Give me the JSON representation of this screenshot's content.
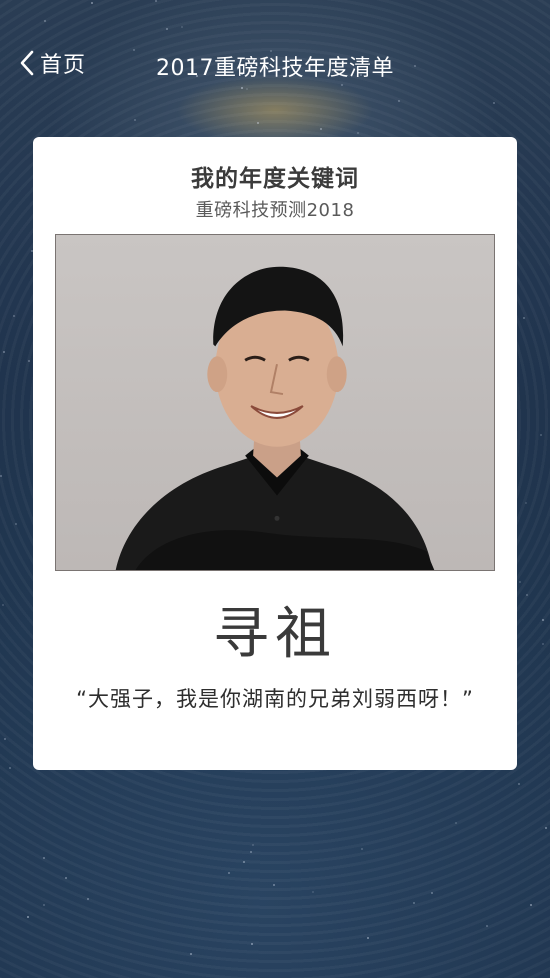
{
  "nav": {
    "back_label": "首页",
    "title": "2017重磅科技年度清单"
  },
  "card": {
    "title": "我的年度关键词",
    "subtitle": "重磅科技预测2018",
    "photo_icon": "portrait-photo",
    "keyword": "寻祖",
    "quote": "“大强子，我是你湖南的兄弟刘弱西呀！”"
  },
  "colors": {
    "background": "#223650",
    "card": "#ffffff",
    "nav_text": "#ffffff"
  }
}
